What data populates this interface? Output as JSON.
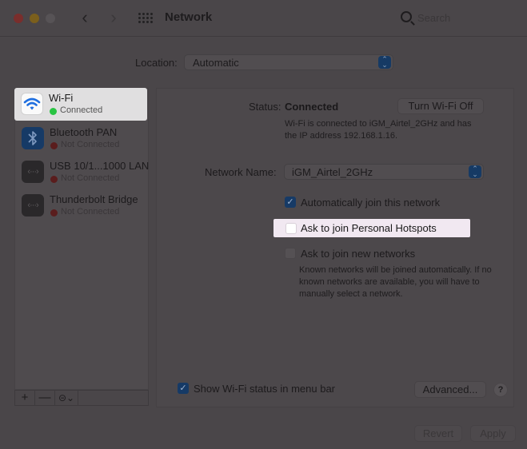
{
  "window": {
    "title": "Network",
    "search_placeholder": "Search",
    "nav": {
      "back": "‹",
      "forward": "›"
    }
  },
  "location": {
    "label": "Location:",
    "value": "Automatic"
  },
  "sidebar": {
    "items": [
      {
        "name": "Wi-Fi",
        "status": "Connected",
        "icon": "wifi-icon",
        "status_color": "#29c443",
        "selected": true
      },
      {
        "name": "Bluetooth PAN",
        "status": "Not Connected",
        "icon": "bluetooth-icon",
        "status_color": "#5a1d1d",
        "selected": false
      },
      {
        "name": "USB 10/1...1000 LAN",
        "status": "Not Connected",
        "icon": "ethernet-icon",
        "status_color": "#5a1d1d",
        "selected": false
      },
      {
        "name": "Thunderbolt Bridge",
        "status": "Not Connected",
        "icon": "ethernet-icon",
        "status_color": "#5a1d1d",
        "selected": false
      }
    ],
    "toolbar": {
      "add": "+",
      "remove": "—",
      "action": "⊝⌄"
    }
  },
  "main": {
    "status_label": "Status:",
    "status_value": "Connected",
    "turn_off_button": "Turn Wi-Fi Off",
    "status_description": "Wi-Fi is connected to iGM_Airtel_2GHz and has the IP address 192.168.1.16.",
    "network_name_label": "Network Name:",
    "network_name_value": "iGM_Airtel_2GHz",
    "options": {
      "auto_join": {
        "label": "Automatically join this network",
        "checked": true
      },
      "personal_hotspots": {
        "label": "Ask to join Personal Hotspots",
        "checked": false
      },
      "new_networks": {
        "label": "Ask to join new networks",
        "checked": false
      }
    },
    "new_networks_description": "Known networks will be joined automatically. If no known networks are available, you will have to manually select a network.",
    "show_status_menubar": {
      "label": "Show Wi-Fi status in menu bar",
      "checked": true
    },
    "advanced_button": "Advanced...",
    "help_button": "?"
  },
  "footer": {
    "revert_button": "Revert",
    "apply_button": "Apply"
  },
  "checkmark": "✓",
  "stepper_glyph": "⌃⌄"
}
